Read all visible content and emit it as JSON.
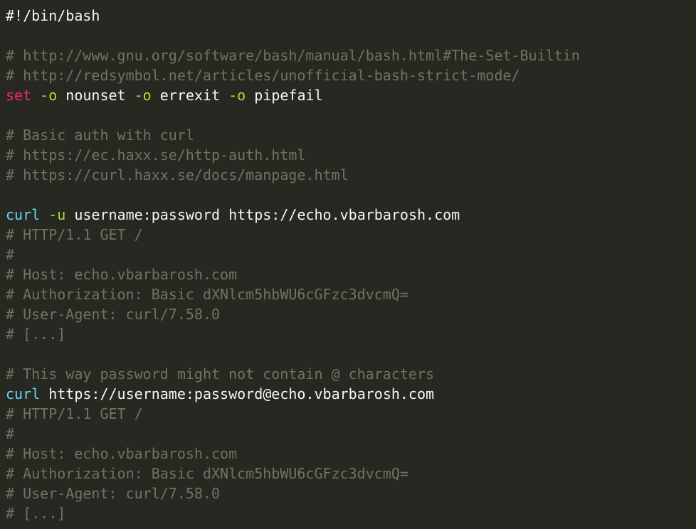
{
  "editor": {
    "lines": [
      {
        "segments": [
          {
            "t": "plain",
            "v": "#!/bin/bash"
          }
        ]
      },
      {
        "segments": []
      },
      {
        "segments": [
          {
            "t": "comment",
            "v": "# http://www.gnu.org/software/bash/manual/bash.html#The-Set-Builtin"
          }
        ]
      },
      {
        "segments": [
          {
            "t": "comment",
            "v": "# http://redsymbol.net/articles/unofficial-bash-strict-mode/"
          }
        ]
      },
      {
        "segments": [
          {
            "t": "kw-set",
            "v": "set"
          },
          {
            "t": "plain",
            "v": " "
          },
          {
            "t": "flag",
            "v": "-o"
          },
          {
            "t": "plain",
            "v": " nounset "
          },
          {
            "t": "flag",
            "v": "-o"
          },
          {
            "t": "plain",
            "v": " errexit "
          },
          {
            "t": "flag",
            "v": "-o"
          },
          {
            "t": "plain",
            "v": " pipefail"
          }
        ]
      },
      {
        "segments": []
      },
      {
        "segments": [
          {
            "t": "comment",
            "v": "# Basic auth with curl"
          }
        ]
      },
      {
        "segments": [
          {
            "t": "comment",
            "v": "# https://ec.haxx.se/http-auth.html"
          }
        ]
      },
      {
        "segments": [
          {
            "t": "comment",
            "v": "# https://curl.haxx.se/docs/manpage.html"
          }
        ]
      },
      {
        "segments": []
      },
      {
        "segments": [
          {
            "t": "kw-cmd",
            "v": "curl"
          },
          {
            "t": "plain",
            "v": " "
          },
          {
            "t": "flag",
            "v": "-u"
          },
          {
            "t": "plain",
            "v": " username:password https://echo.vbarbarosh.com"
          }
        ]
      },
      {
        "segments": [
          {
            "t": "comment",
            "v": "# HTTP/1.1 GET /"
          }
        ]
      },
      {
        "segments": [
          {
            "t": "comment",
            "v": "#"
          }
        ]
      },
      {
        "segments": [
          {
            "t": "comment",
            "v": "# Host: echo.vbarbarosh.com"
          }
        ]
      },
      {
        "segments": [
          {
            "t": "comment",
            "v": "# Authorization: Basic dXNlcm5hbWU6cGFzc3dvcmQ="
          }
        ]
      },
      {
        "segments": [
          {
            "t": "comment",
            "v": "# User-Agent: curl/7.58.0"
          }
        ]
      },
      {
        "segments": [
          {
            "t": "comment",
            "v": "# [...]"
          }
        ]
      },
      {
        "segments": []
      },
      {
        "segments": [
          {
            "t": "comment",
            "v": "# This way password might not contain @ characters"
          }
        ]
      },
      {
        "segments": [
          {
            "t": "kw-cmd",
            "v": "curl"
          },
          {
            "t": "plain",
            "v": " https://username:password@echo.vbarbarosh.com"
          }
        ]
      },
      {
        "segments": [
          {
            "t": "comment",
            "v": "# HTTP/1.1 GET /"
          }
        ]
      },
      {
        "segments": [
          {
            "t": "comment",
            "v": "#"
          }
        ]
      },
      {
        "segments": [
          {
            "t": "comment",
            "v": "# Host: echo.vbarbarosh.com"
          }
        ]
      },
      {
        "segments": [
          {
            "t": "comment",
            "v": "# Authorization: Basic dXNlcm5hbWU6cGFzc3dvcmQ="
          }
        ]
      },
      {
        "segments": [
          {
            "t": "comment",
            "v": "# User-Agent: curl/7.58.0"
          }
        ]
      },
      {
        "segments": [
          {
            "t": "comment",
            "v": "# [...]"
          }
        ]
      }
    ]
  },
  "colors": {
    "background": "#272822",
    "text": "#f8f8f2",
    "comment": "#75715e",
    "keyword_set": "#f92672",
    "command": "#66d9ef",
    "flag": "#a6e22e"
  }
}
